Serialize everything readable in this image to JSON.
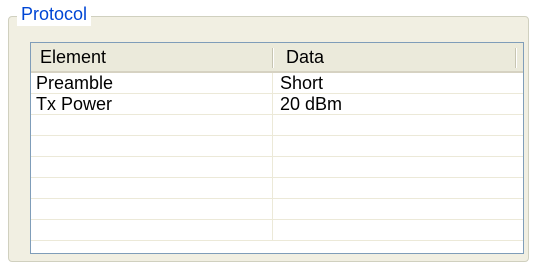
{
  "group": {
    "title": "Protocol"
  },
  "table": {
    "columns": [
      "Element",
      "Data"
    ],
    "rows": [
      [
        "Preamble",
        "Short"
      ],
      [
        "Tx Power",
        "20 dBm"
      ],
      [
        "",
        ""
      ],
      [
        "",
        ""
      ],
      [
        "",
        ""
      ],
      [
        "",
        ""
      ],
      [
        "",
        ""
      ],
      [
        "",
        ""
      ]
    ]
  }
}
